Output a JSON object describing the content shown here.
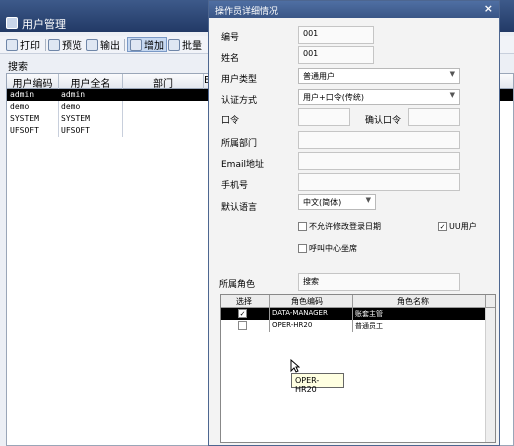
{
  "bg_window": {
    "title": "用户管理",
    "toolbar": {
      "print": "打印",
      "preview": "预览",
      "export": "输出",
      "add": "增加",
      "batch": "批量"
    },
    "search_label": "搜索",
    "columns": [
      "用户编码",
      "用户全名",
      "部门",
      "En"
    ],
    "rows": [
      {
        "code": "admin",
        "name": "admin"
      },
      {
        "code": "demo",
        "name": "demo"
      },
      {
        "code": "SYSTEM",
        "name": "SYSTEM"
      },
      {
        "code": "UFSOFT",
        "name": "UFSOFT"
      }
    ]
  },
  "dialog": {
    "title": "操作员详细情况",
    "close_glyph": "×",
    "fields": {
      "code_label": "编号",
      "code_value": "001",
      "name_label": "姓名",
      "name_value": "001",
      "usertype_label": "用户类型",
      "usertype_value": "普通用户",
      "auth_label": "认证方式",
      "auth_value": "用户+口令(传统)",
      "password_label": "口令",
      "password_value": "",
      "confirm_label": "确认口令",
      "confirm_value": "",
      "dept_label": "所属部门",
      "dept_value": "",
      "email_label": "Email地址",
      "email_value": "",
      "phone_label": "手机号",
      "phone_value": "",
      "lang_label": "默认语言",
      "lang_value": "中文(简体)"
    },
    "checkboxes": {
      "no_change_login_date": "不允许修改登录日期",
      "uu_user": "UU用户",
      "call_center": "呼叫中心坐席"
    },
    "roles": {
      "label": "所属角色",
      "search": "搜索",
      "columns": [
        "选择",
        "角色编码",
        "角色名称"
      ],
      "rows": [
        {
          "checked": "✓",
          "code": "DATA-MANAGER",
          "name": "账套主管"
        },
        {
          "checked": "",
          "code": "OPER-HR20",
          "name": "普通员工"
        }
      ]
    },
    "tooltip": "OPER-HR20"
  }
}
